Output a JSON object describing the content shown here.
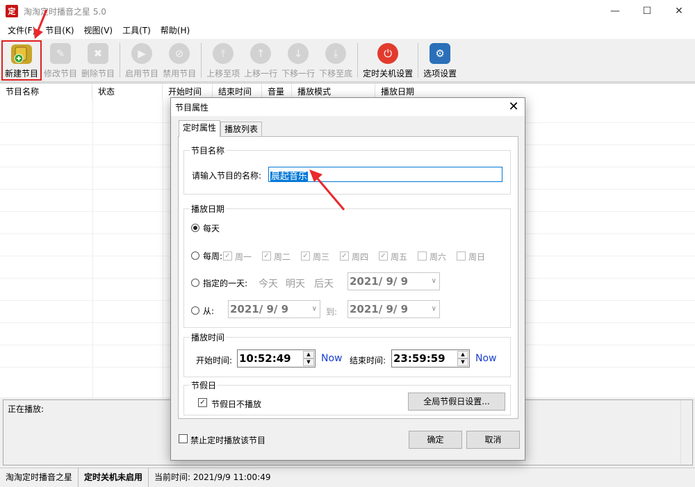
{
  "window": {
    "title": "淘淘定时播音之星 5.0",
    "app_icon_text": "定"
  },
  "menu": [
    "文件(F)",
    "节目(K)",
    "视图(V)",
    "工具(T)",
    "帮助(H)"
  ],
  "toolbar": {
    "new": "新建节目",
    "edit": "修改节目",
    "delete": "删除节目",
    "enable": "启用节目",
    "disable": "禁用节目",
    "move_top": "上移至项",
    "move_up": "上移一行",
    "move_down": "下移一行",
    "move_bottom": "下移至底",
    "shutdown": "定时关机设置",
    "options": "选项设置"
  },
  "list": {
    "columns": [
      "节目名称",
      "状态",
      "开始时间",
      "结束时间",
      "音量",
      "播放模式",
      "播放日期"
    ]
  },
  "now_playing": {
    "label": "正在播放:"
  },
  "statusbar": {
    "app": "淘淘定时播音之星",
    "shutdown_status": "定时关机未启用",
    "current_time": "当前时间:  2021/9/9 11:00:49"
  },
  "dialog": {
    "title": "节目属性",
    "tabs": [
      "定时属性",
      "播放列表"
    ],
    "name_group": {
      "title": "节目名称",
      "label": "请输入节目的名称:",
      "value": "晨起音乐"
    },
    "date_group": {
      "title": "播放日期",
      "everyday": "每天",
      "weekly": "每周:",
      "weekdays": [
        {
          "label": "周一",
          "checked": true
        },
        {
          "label": "周二",
          "checked": true
        },
        {
          "label": "周三",
          "checked": true
        },
        {
          "label": "周四",
          "checked": true
        },
        {
          "label": "周五",
          "checked": true
        },
        {
          "label": "周六",
          "checked": false
        },
        {
          "label": "周日",
          "checked": false
        }
      ],
      "specific_day": "指定的一天:",
      "today": "今天",
      "tomorrow": "明天",
      "day_after": "后天",
      "specific_date": "2021/  9/  9",
      "from": "从:",
      "from_date": "2021/  9/  9",
      "to": "到:",
      "to_date": "2021/  9/  9",
      "selected": "everyday"
    },
    "time_group": {
      "title": "播放时间",
      "start_label": "开始时间:",
      "start_value": "10:52:49",
      "now": "Now",
      "end_label": "结束时间:",
      "end_value": "23:59:59"
    },
    "holiday_group": {
      "title": "节假日",
      "no_play_label": "节假日不播放",
      "no_play_checked": true,
      "settings_button": "全局节假日设置..."
    },
    "disable_checkbox": "禁止定时播放该节目",
    "ok": "确定",
    "cancel": "取消"
  },
  "colors": {
    "accent": "#0078d7",
    "highlight_border": "#e02020",
    "annotation_arrow": "#e8282d",
    "link": "#1a3fcf"
  }
}
